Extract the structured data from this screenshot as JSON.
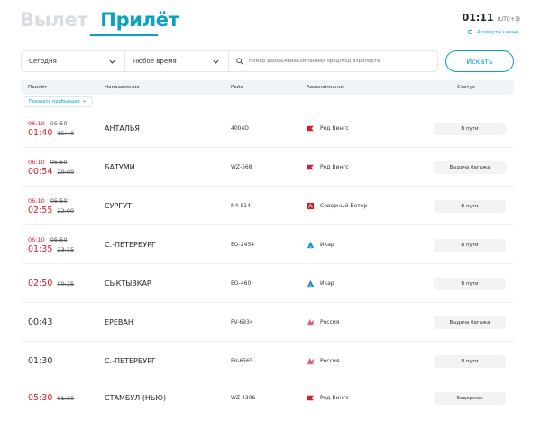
{
  "tabs": {
    "departure": "Вылет",
    "arrival": "Прилёт"
  },
  "clock": {
    "time": "01:11",
    "tz": "(UTC+3)",
    "refresh": "2 минуты назад"
  },
  "filters": {
    "day": "Сегодня",
    "time": "Любое время",
    "search_placeholder": "Номер рейса/Авиакомпания/Город/Код аэропорта",
    "search_button": "Искать"
  },
  "table": {
    "headers": {
      "arrival": "Прилёт",
      "direction": "Направление",
      "flight": "Рейс",
      "airline": "Авиакомпания",
      "status": "Статус"
    },
    "show_arrivals": "Показать прибывшие"
  },
  "rows": [
    {
      "top_new": "06:10",
      "top_old": "05:50",
      "main_new": "01:40",
      "main_old": "15:40",
      "destination": "АНТАЛЬЯ",
      "flight": "4004D",
      "airline": "Ред Вингс",
      "airline_icon": "redwings-logo-icon",
      "status": "В пути"
    },
    {
      "top_new": "06:10",
      "top_old": "05:50",
      "main_new": "00:54",
      "main_old": "20:00",
      "destination": "БАТУМИ",
      "flight": "WZ-568",
      "airline": "Ред Вингс",
      "airline_icon": "redwings-logo-icon",
      "status": "Выдача багажа"
    },
    {
      "top_new": "06:10",
      "top_old": "05:50",
      "main_new": "02:55",
      "main_old": "22:00",
      "destination": "СУРГУТ",
      "flight": "N4-514",
      "airline": "Северный Ветер",
      "airline_icon": "nordwind-logo-icon",
      "status": "В пути"
    },
    {
      "top_new": "06:10",
      "top_old": "05:50",
      "main_new": "01:35",
      "main_old": "23:15",
      "destination": "С.-ПЕТЕРБУРГ",
      "flight": "EO-2454",
      "airline": "Икар",
      "airline_icon": "ikar-logo-icon",
      "status": "В пути"
    },
    {
      "main_new": "02:50",
      "main_old": "00:25",
      "destination": "СЫКТЫВКАР",
      "flight": "EO-460",
      "airline": "Икар",
      "airline_icon": "ikar-logo-icon",
      "status": "В пути"
    },
    {
      "main_plain": "00:43",
      "destination": "ЕРЕВАН",
      "flight": "FV-6934",
      "airline": "Россия",
      "airline_icon": "rossiya-logo-icon",
      "status": "Выдача багажа"
    },
    {
      "main_plain": "01:30",
      "destination": "С.-ПЕТЕРБУРГ",
      "flight": "FV-6565",
      "airline": "Россия",
      "airline_icon": "rossiya-logo-icon",
      "status": "В пути"
    },
    {
      "main_new": "05:30",
      "main_old": "01:30",
      "destination": "СТАМБУЛ (НЬЮ)",
      "flight": "WZ-4306",
      "airline": "Ред Вингс",
      "airline_icon": "redwings-logo-icon",
      "status": "Задержан"
    }
  ],
  "colors": {
    "accent": "#0aa2c0",
    "delay_red": "#d22030",
    "header_bg": "#eef4f8",
    "status_bg": "#f2f3f5"
  }
}
